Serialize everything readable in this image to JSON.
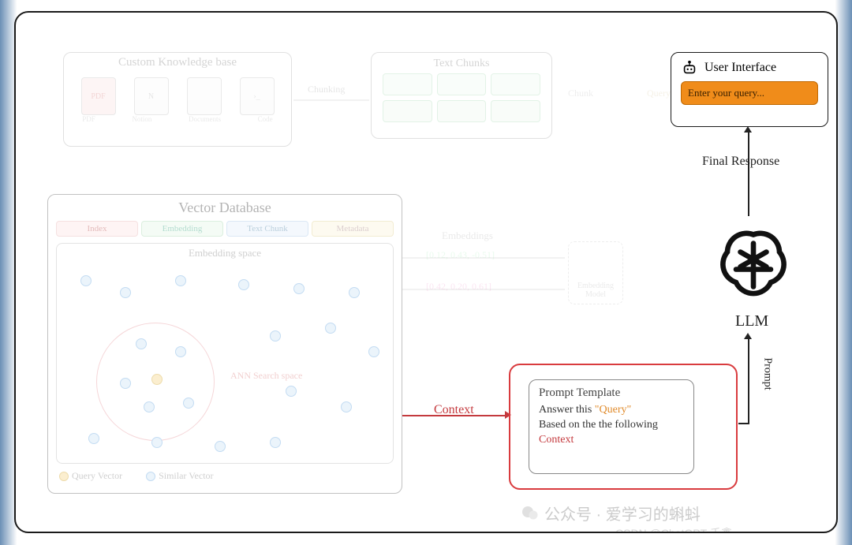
{
  "kb": {
    "title": "Custom Knowledge base",
    "icons": [
      "PDF",
      "N",
      "",
      "›_"
    ],
    "labels": [
      "PDF",
      "Notion",
      "Documents",
      "Code"
    ]
  },
  "tc": {
    "title": "Text Chunks"
  },
  "edge_labels": {
    "chunking": "Chunking",
    "chunk": "Chunk",
    "query": "Query",
    "embeddings": "Embeddings",
    "context": "Context",
    "final_response": "Final Response",
    "prompt": "Prompt"
  },
  "embed_vectors": {
    "v1": "[0.12, 0.43, -0.51]",
    "v2": "[0.42, 0.20, 0.61]"
  },
  "embed_model": "Embedding Model",
  "vdb": {
    "title": "Vector Database",
    "cols": {
      "index": "Index",
      "embedding": "Embedding",
      "text_chunk": "Text Chunk",
      "metadata": "Metadata"
    },
    "space_title": "Embedding space",
    "ann_label": "ANN Search space",
    "legend": {
      "query": "Query Vector",
      "similar": "Similar Vector"
    }
  },
  "ui": {
    "title": "User Interface",
    "placeholder": "Enter your query..."
  },
  "llm": {
    "label": "LLM"
  },
  "pt": {
    "title": "Prompt Template",
    "line1_pre": "Answer this ",
    "line1_q": "\"Query\"",
    "line2": "Based on the the following ",
    "line2_c": "Context"
  },
  "watermark": {
    "line1": "公众号 · 爱学习的蝌蚪",
    "line2": "CSDN @ChatGPT-千鑫"
  }
}
